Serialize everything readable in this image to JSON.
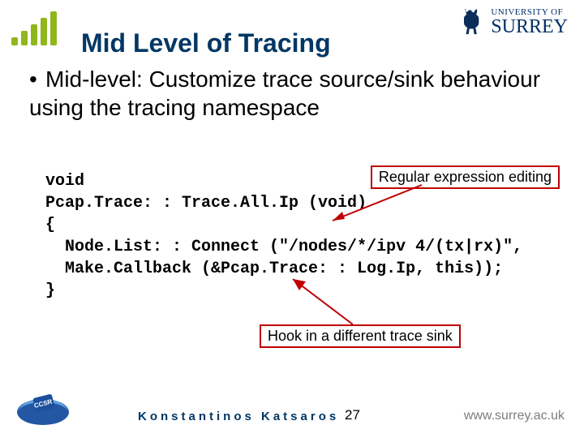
{
  "header": {
    "title": "Mid Level of Tracing",
    "uni_small": "UNIVERSITY OF",
    "uni_large": "SURREY"
  },
  "body": {
    "bullet": "Mid-level: Customize trace source/sink behaviour using the tracing namespace",
    "code": "void\nPcap.Trace: : Trace.All.Ip (void)\n{\n  Node.List: : Connect (\"/nodes/*/ipv 4/(tx|rx)\",\n  Make.Callback (&Pcap.Trace: : Log.Ip, this));\n}",
    "callout1": "Regular expression editing",
    "callout2": "Hook in a different trace sink"
  },
  "footer": {
    "author": "Konstantinos  Katsaros",
    "page": "27",
    "url": "www.surrey.ac.uk"
  }
}
